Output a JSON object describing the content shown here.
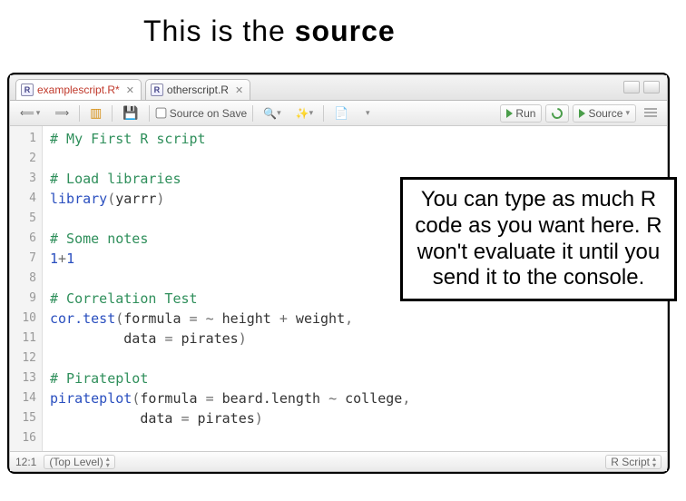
{
  "overlay": {
    "title_a": "This is the ",
    "title_b": "source",
    "callout": "You can type as much R code as you want here. R won't evaluate it until you send it to the console."
  },
  "tabs": [
    {
      "name": "examplescript.R*",
      "active": true,
      "dirty": true
    },
    {
      "name": "otherscript.R",
      "active": false,
      "dirty": false
    }
  ],
  "toolbar": {
    "source_on_save": "Source on Save",
    "run": "Run",
    "source": "Source"
  },
  "code_lines": [
    {
      "n": 1,
      "tokens": [
        [
          "comment",
          "# My First R script"
        ]
      ]
    },
    {
      "n": 2,
      "tokens": []
    },
    {
      "n": 3,
      "tokens": [
        [
          "comment",
          "# Load libraries"
        ]
      ]
    },
    {
      "n": 4,
      "tokens": [
        [
          "func",
          "library"
        ],
        [
          "punc",
          "("
        ],
        [
          "var",
          "yarrr"
        ],
        [
          "punc",
          ")"
        ]
      ]
    },
    {
      "n": 5,
      "tokens": []
    },
    {
      "n": 6,
      "tokens": [
        [
          "comment",
          "# Some notes"
        ]
      ]
    },
    {
      "n": 7,
      "tokens": [
        [
          "num",
          "1"
        ],
        [
          "op",
          "+"
        ],
        [
          "num",
          "1"
        ]
      ]
    },
    {
      "n": 8,
      "tokens": []
    },
    {
      "n": 9,
      "tokens": [
        [
          "comment",
          "# Correlation Test"
        ]
      ]
    },
    {
      "n": 10,
      "tokens": [
        [
          "func",
          "cor.test"
        ],
        [
          "punc",
          "("
        ],
        [
          "var",
          "formula "
        ],
        [
          "op",
          "="
        ],
        [
          "var",
          " "
        ],
        [
          "op",
          "~"
        ],
        [
          "var",
          " height "
        ],
        [
          "op",
          "+"
        ],
        [
          "var",
          " weight"
        ],
        [
          "punc",
          ","
        ]
      ]
    },
    {
      "n": 11,
      "tokens": [
        [
          "var",
          "         data "
        ],
        [
          "op",
          "="
        ],
        [
          "var",
          " pirates"
        ],
        [
          "punc",
          ")"
        ]
      ]
    },
    {
      "n": 12,
      "tokens": []
    },
    {
      "n": 13,
      "tokens": [
        [
          "comment",
          "# Pirateplot"
        ]
      ]
    },
    {
      "n": 14,
      "tokens": [
        [
          "func",
          "pirateplot"
        ],
        [
          "punc",
          "("
        ],
        [
          "var",
          "formula "
        ],
        [
          "op",
          "="
        ],
        [
          "var",
          " beard.length "
        ],
        [
          "op",
          "~"
        ],
        [
          "var",
          " college"
        ],
        [
          "punc",
          ","
        ]
      ]
    },
    {
      "n": 15,
      "tokens": [
        [
          "var",
          "           data "
        ],
        [
          "op",
          "="
        ],
        [
          "var",
          " pirates"
        ],
        [
          "punc",
          ")"
        ]
      ]
    },
    {
      "n": 16,
      "tokens": []
    }
  ],
  "status": {
    "pos": "12:1",
    "scope": "(Top Level)",
    "filetype": "R Script"
  }
}
